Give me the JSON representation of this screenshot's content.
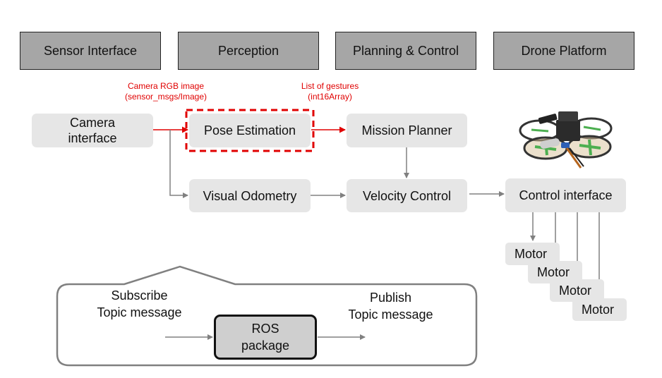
{
  "headers": [
    "Sensor Interface",
    "Perception",
    "Planning & Control",
    "Drone Platform"
  ],
  "labels": {
    "camera_msg_line1": "Camera RGB image",
    "camera_msg_line2": "(sensor_msgs/Image)",
    "gesture_msg_line1": "List of gestures",
    "gesture_msg_line2": "(int16Array)"
  },
  "nodes": {
    "camera_line1": "Camera",
    "camera_line2": "interface",
    "pose_estimation": "Pose Estimation",
    "mission_planner": "Mission Planner",
    "visual_odometry": "Visual Odometry",
    "velocity_control": "Velocity Control",
    "control_interface": "Control interface"
  },
  "motors": [
    "Motor",
    "Motor",
    "Motor",
    "Motor"
  ],
  "legend": {
    "subscribe_line1": "Subscribe",
    "subscribe_line2": "Topic message",
    "publish_line1": "Publish",
    "publish_line2": "Topic message",
    "package_line1": "ROS",
    "package_line2": "package"
  },
  "colors": {
    "header_fill": "#a6a6a6",
    "node_fill": "#e6e6e6",
    "highlight": "#e00000",
    "wire": "#808080"
  },
  "image": {
    "drone_photo": "quadrotor-drone-image"
  }
}
